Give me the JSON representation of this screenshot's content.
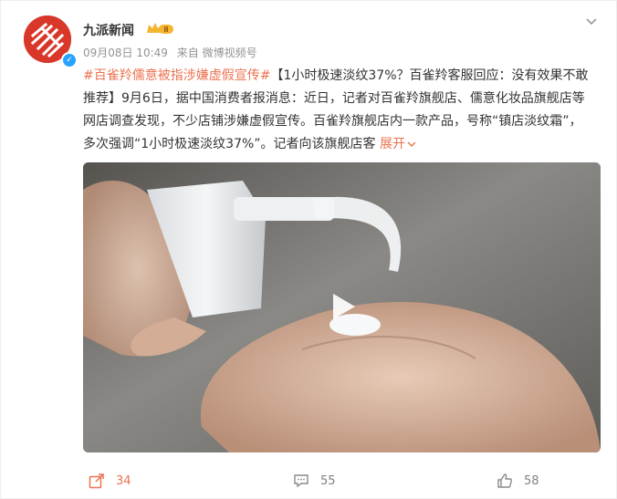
{
  "post": {
    "author": "九派新闻",
    "date": "09月08日 10:49",
    "source": "来自 微博视频号",
    "hashtag": "#百雀羚儒意被指涉嫌虚假宣传#",
    "body": "【1小时极速淡纹37%？百雀羚客服回应：没有效果不敢推荐】9月6日，据中国消费者报消息：近日，记者对百雀羚旗舰店、儒意化妆品旗舰店等网店调查发现，不少店铺涉嫌虚假宣传。百雀羚旗舰店内一款产品，号称“镇店淡纹霜”，多次强调“1小时极速淡纹37%”。记者向该旗舰店客 ",
    "expand_label": "展开",
    "level_badge": "Ⅲ"
  },
  "footer": {
    "share_count": "34",
    "comment_count": "55",
    "like_count": "58"
  },
  "colors": {
    "accent": "#eb7350",
    "avatar_bg": "#d8372a",
    "verify_blue": "#2aa3ff",
    "badge_gold": "#f6b52f"
  },
  "icons": {
    "menu": "chevron-down-icon",
    "share": "share-icon",
    "comment": "comment-icon",
    "like": "thumbs-up-icon",
    "play": "play-icon"
  }
}
